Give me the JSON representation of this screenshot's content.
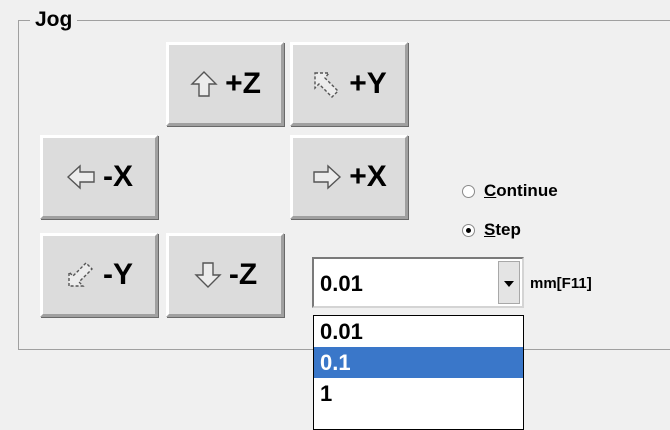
{
  "group": {
    "title": "Jog"
  },
  "buttons": {
    "z_plus": {
      "label": "+Z",
      "icon": "arrow-up-icon"
    },
    "y_plus": {
      "label": "+Y",
      "icon": "arrow-up-left-icon"
    },
    "x_minus": {
      "label": "-X",
      "icon": "arrow-left-icon"
    },
    "x_plus": {
      "label": "+X",
      "icon": "arrow-right-icon"
    },
    "y_minus": {
      "label": "-Y",
      "icon": "arrow-down-left-icon"
    },
    "z_minus": {
      "label": "-Z",
      "icon": "arrow-down-icon"
    }
  },
  "mode": {
    "continue_label": "Continue",
    "continue_access_key": "C",
    "continue_rest": "ontinue",
    "step_label": "Step",
    "step_access_key": "S",
    "step_rest": "tep",
    "selected": "Step"
  },
  "step_size": {
    "value": "0.01",
    "unit_label": "mm[F11]",
    "options": [
      "0.01",
      "0.1",
      "1"
    ],
    "highlighted": "0.1"
  },
  "colors": {
    "highlight": "#3a77c9",
    "button_face": "#dcdcdc",
    "background": "#f0f0f0"
  }
}
